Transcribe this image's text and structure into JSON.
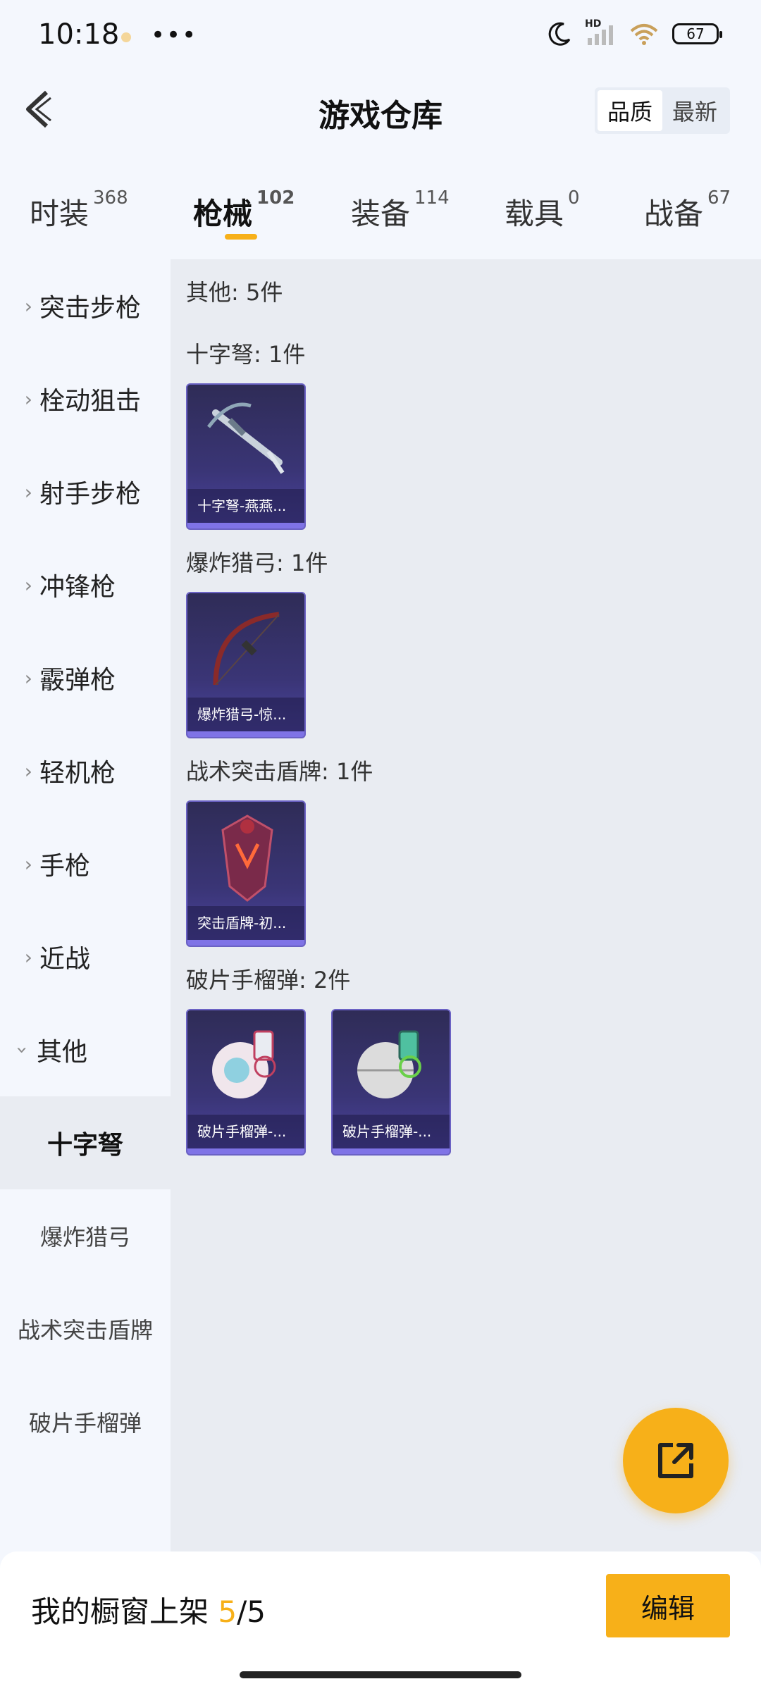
{
  "status_bar": {
    "time": "10:18",
    "battery": "67",
    "network": "HD"
  },
  "header": {
    "title": "游戏仓库",
    "sort_options": [
      "品质",
      "最新"
    ],
    "sort_selected": "品质"
  },
  "tabs": [
    {
      "label": "时装",
      "count": "368"
    },
    {
      "label": "枪械",
      "count": "102"
    },
    {
      "label": "装备",
      "count": "114"
    },
    {
      "label": "载具",
      "count": "0"
    },
    {
      "label": "战备",
      "count": "67"
    }
  ],
  "active_tab": "枪械",
  "sidebar": {
    "categories": [
      "突击步枪",
      "栓动狙击",
      "射手步枪",
      "冲锋枪",
      "霰弹枪",
      "轻机枪",
      "手枪",
      "近战",
      "其他"
    ],
    "subcategories": [
      "十字弩",
      "爆炸猎弓",
      "战术突击盾牌",
      "破片手榴弹"
    ],
    "selected_sub": "十字弩"
  },
  "content": {
    "summary": "其他: 5件",
    "groups": [
      {
        "label": "十字弩: 1件",
        "items": [
          "十字弩-燕燕..."
        ]
      },
      {
        "label": "爆炸猎弓: 1件",
        "items": [
          "爆炸猎弓-惊..."
        ]
      },
      {
        "label": "战术突击盾牌: 1件",
        "items": [
          "突击盾牌-初..."
        ]
      },
      {
        "label": "破片手榴弹: 2件",
        "items": [
          "破片手榴弹-...",
          "破片手榴弹-..."
        ]
      }
    ]
  },
  "bottom": {
    "showcase_label": "我的橱窗上架",
    "showcase_count": "5",
    "showcase_total": "/5",
    "edit_label": "编辑"
  },
  "colors": {
    "accent": "#f7b019",
    "card_bg": "#3a3576",
    "content_bg": "#e9ecf2"
  }
}
